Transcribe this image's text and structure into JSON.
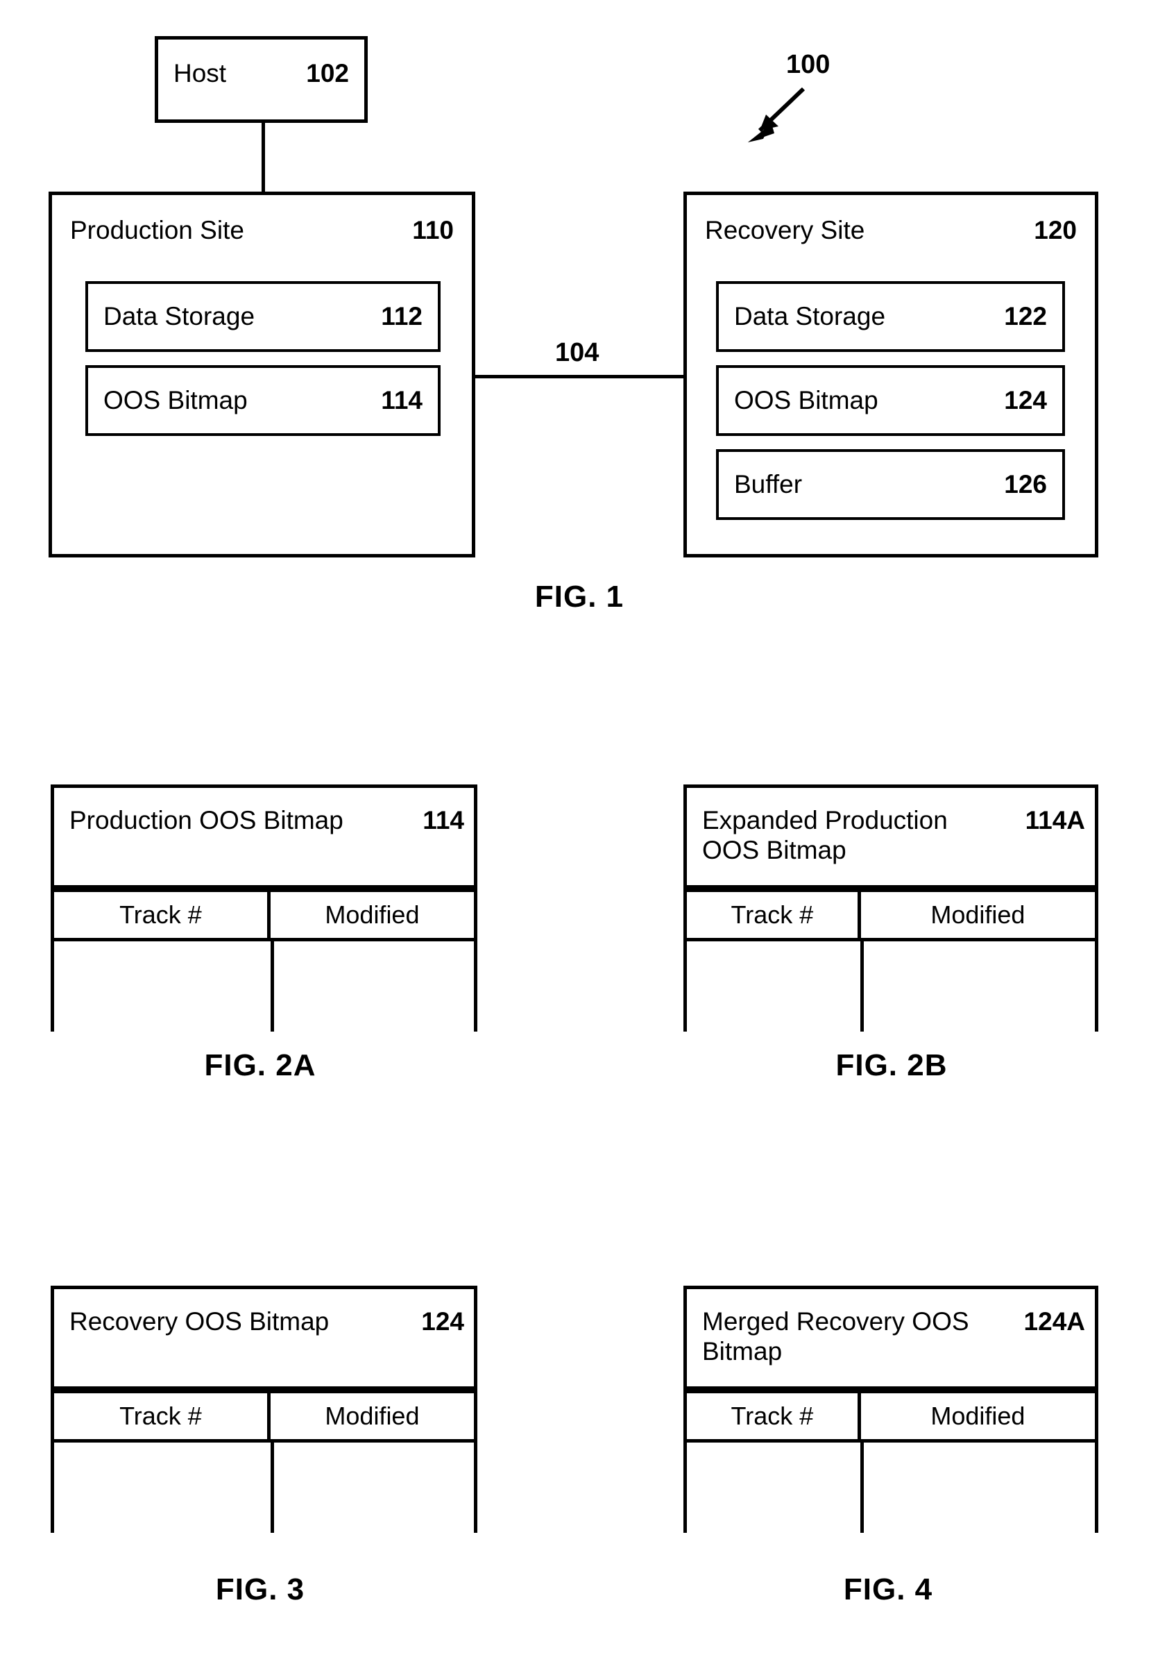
{
  "figure1": {
    "callout": {
      "label": "100"
    },
    "host": {
      "label": "Host",
      "ref": "102"
    },
    "link": {
      "ref": "104"
    },
    "production_site": {
      "label": "Production Site",
      "ref": "110",
      "components": [
        {
          "label": "Data Storage",
          "ref": "112"
        },
        {
          "label": "OOS Bitmap",
          "ref": "114"
        }
      ]
    },
    "recovery_site": {
      "label": "Recovery Site",
      "ref": "120",
      "components": [
        {
          "label": "Data Storage",
          "ref": "122"
        },
        {
          "label": "OOS Bitmap",
          "ref": "124"
        },
        {
          "label": "Buffer",
          "ref": "126"
        }
      ]
    },
    "caption": "FIG. 1"
  },
  "figure2a": {
    "table": {
      "title_line1": "Production OOS Bitmap",
      "title_line2": "",
      "ref": "114",
      "columns": [
        "Track #",
        "Modified"
      ],
      "rows": []
    },
    "caption": "FIG. 2A"
  },
  "figure2b": {
    "table": {
      "title_line1": "Expanded Production",
      "title_line2": "OOS Bitmap",
      "ref": "114A",
      "columns": [
        "Track #",
        "Modified"
      ],
      "rows": []
    },
    "caption": "FIG. 2B"
  },
  "figure3": {
    "table": {
      "title_line1": "Recovery OOS Bitmap",
      "title_line2": "",
      "ref": "124",
      "columns": [
        "Track #",
        "Modified"
      ],
      "rows": []
    },
    "caption": "FIG. 3"
  },
  "figure4": {
    "table": {
      "title_line1": "Merged Recovery OOS",
      "title_line2": "Bitmap",
      "ref": "124A",
      "columns": [
        "Track #",
        "Modified"
      ],
      "rows": []
    },
    "caption": "FIG. 4"
  },
  "colors": {
    "ink": "#000000",
    "paper": "#ffffff"
  }
}
